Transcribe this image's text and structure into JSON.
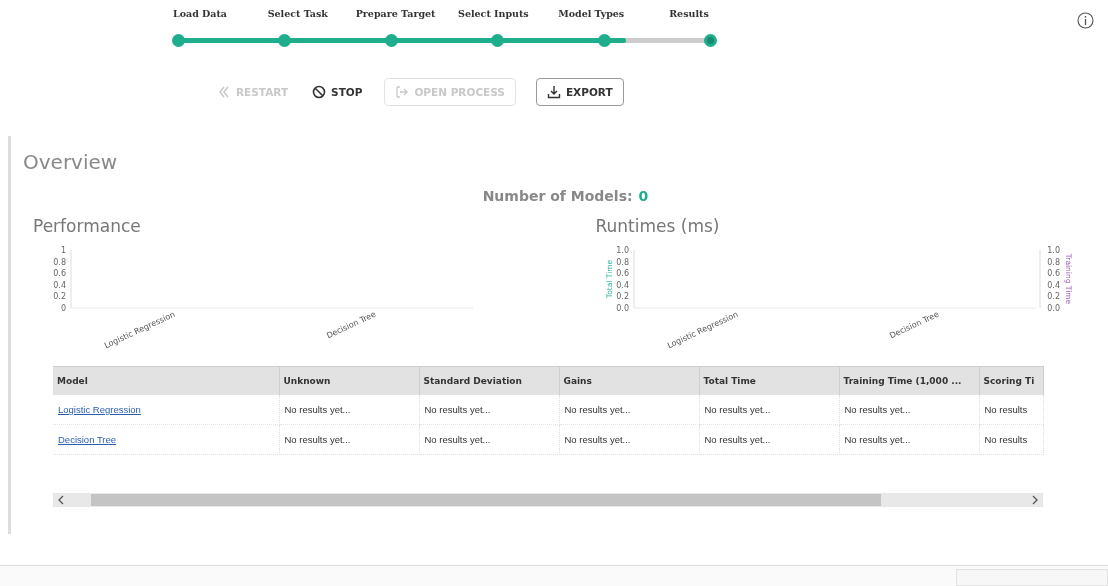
{
  "stepper": {
    "level": 0.84,
    "steps": [
      {
        "label": "Load Data",
        "selected": false
      },
      {
        "label": "Select Task",
        "selected": false
      },
      {
        "label": "Prepare Target",
        "selected": false
      },
      {
        "label": "Select Inputs",
        "selected": false
      },
      {
        "label": "Model Types",
        "selected": false
      },
      {
        "label": "Results",
        "selected": true
      }
    ]
  },
  "actions": [
    {
      "kind": "restart",
      "label": "RESTART",
      "disabled": true
    },
    {
      "kind": "stop",
      "label": "STOP",
      "disabled": false
    },
    {
      "kind": "open",
      "label": "OPEN PROCESS",
      "disabled": true
    },
    {
      "kind": "export",
      "label": "EXPORT",
      "disabled": false
    }
  ],
  "overview": {
    "title": "Overview",
    "models_label": "Number of Models:",
    "models_count": "0",
    "charts": [
      {
        "title": "Performance",
        "chart_data": {
          "type": "bar",
          "categories": [
            "Logistic Regression",
            "Decision Tree"
          ],
          "values": [
            null,
            null
          ],
          "ylim": [
            0,
            1
          ],
          "yticks": [
            0,
            0.2,
            0.4,
            0.6,
            0.8,
            1
          ]
        }
      },
      {
        "title": "Runtimes (ms)",
        "chart_data": {
          "type": "bar",
          "categories": [
            "Logistic Regression",
            "Decision Tree"
          ],
          "series": [
            {
              "name": "Total Time",
              "color": "#2bb39a",
              "values": [
                null,
                null
              ]
            },
            {
              "name": "Training Time",
              "color": "#9b59b6",
              "values": [
                null,
                null
              ]
            }
          ],
          "ylim": [
            0,
            1
          ],
          "yticks": [
            {
              "value": 0,
              "label": "0.0"
            },
            {
              "value": 0.2,
              "label": "0.2"
            },
            {
              "value": 0.4,
              "label": "0.4"
            },
            {
              "value": 0.6,
              "label": "0.6"
            },
            {
              "value": 0.8,
              "label": "0.8"
            },
            {
              "value": 1,
              "label": "1.0"
            }
          ]
        }
      }
    ]
  },
  "table": {
    "columns": [
      "Model",
      "Unknown",
      "Standard Deviation",
      "Gains",
      "Total Time",
      "Training Time (1,000 ...",
      "Scoring Ti"
    ],
    "rows": [
      {
        "cells": [
          "Logistic Regression",
          "No results yet...",
          "No results yet...",
          "No results yet...",
          "No results yet...",
          "No results yet...",
          "No results"
        ]
      },
      {
        "cells": [
          "Decision Tree",
          "No results yet...",
          "No results yet...",
          "No results yet...",
          "No results yet...",
          "No results yet...",
          "No results"
        ]
      }
    ]
  }
}
